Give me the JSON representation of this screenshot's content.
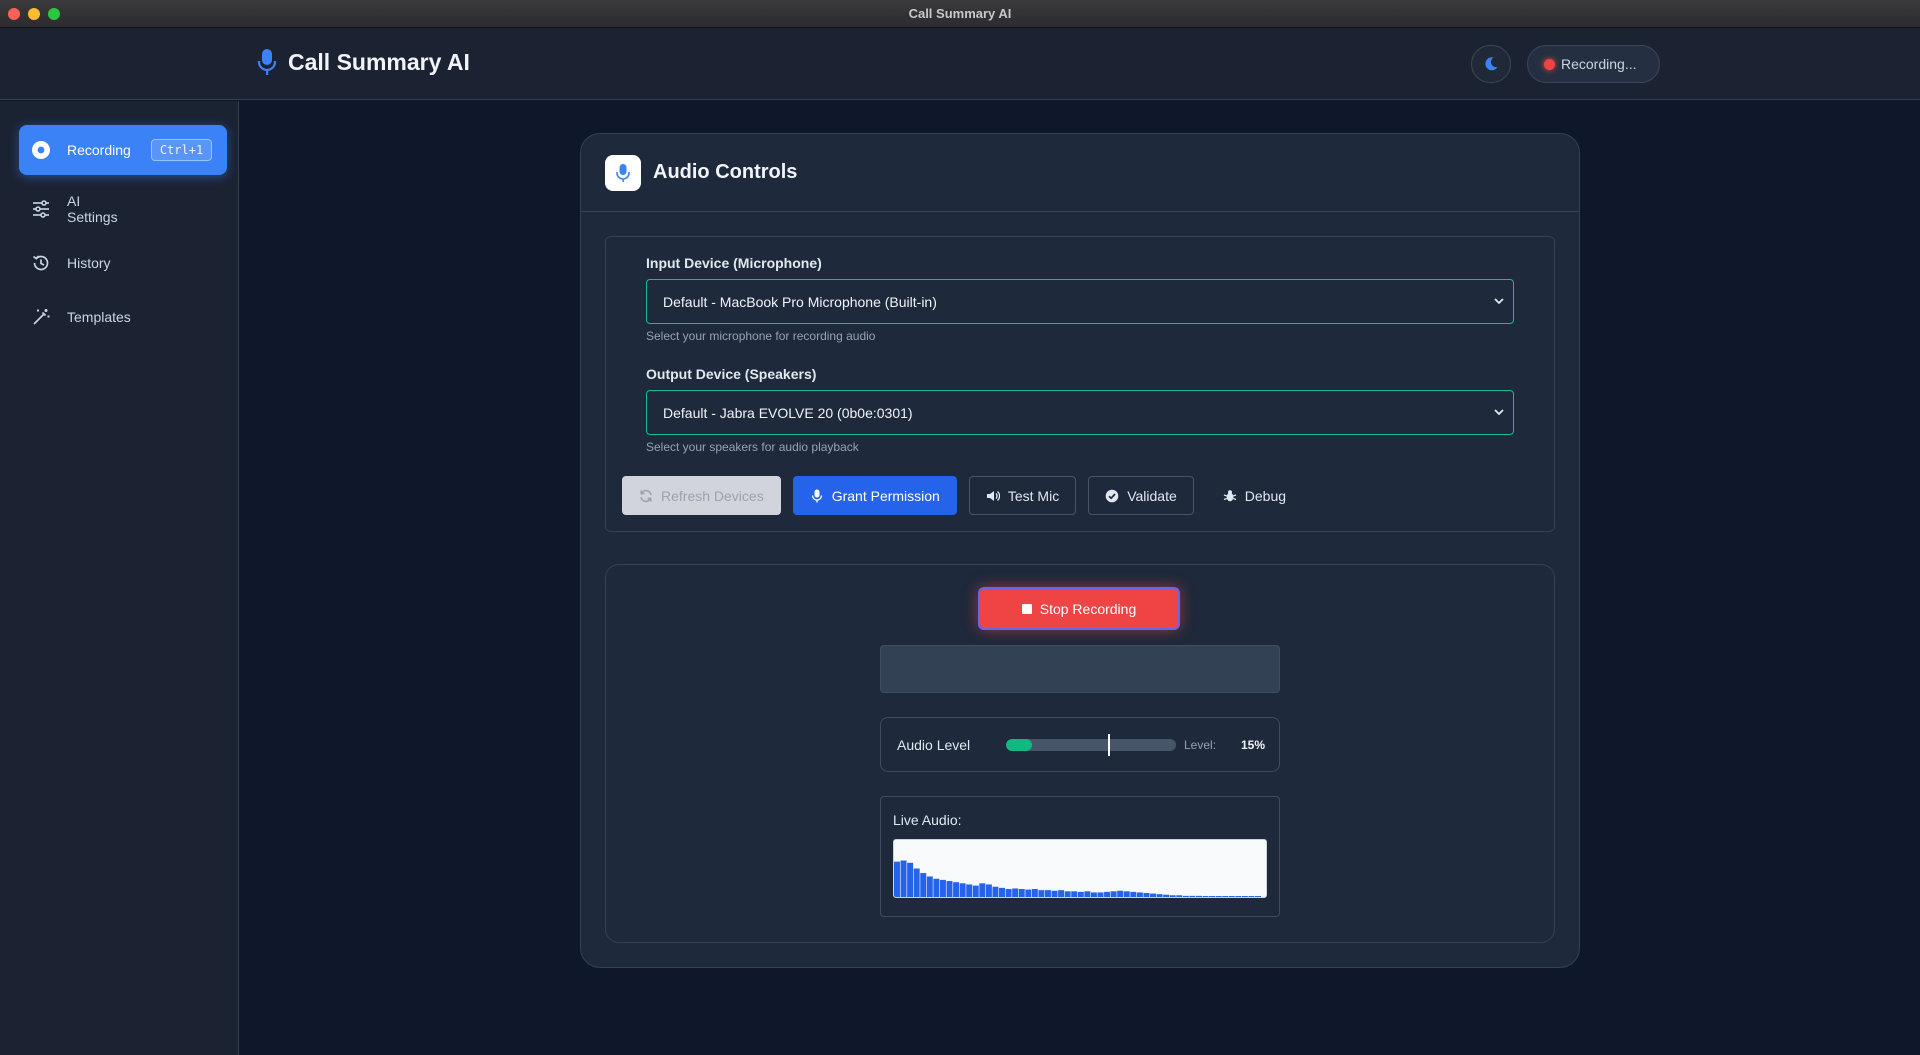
{
  "window": {
    "title": "Call Summary AI"
  },
  "header": {
    "app_title": "Call Summary AI",
    "recording_status": "Recording..."
  },
  "sidebar": {
    "items": [
      {
        "label": "Recording",
        "shortcut": "Ctrl+1",
        "icon": "record-icon",
        "active": true
      },
      {
        "label": "AI\nSettings",
        "icon": "sliders-icon",
        "active": false
      },
      {
        "label": "History",
        "icon": "history-icon",
        "active": false
      },
      {
        "label": "Templates",
        "icon": "magic-wand-icon",
        "active": false
      }
    ]
  },
  "card": {
    "title": "Audio Controls",
    "input_device": {
      "label": "Input Device (Microphone)",
      "value": "Default - MacBook Pro Microphone (Built-in)",
      "hint": "Select your microphone for recording audio"
    },
    "output_device": {
      "label": "Output Device (Speakers)",
      "value": "Default - Jabra EVOLVE 20 (0b0e:0301)",
      "hint": "Select your speakers for audio playback"
    },
    "buttons": {
      "refresh": "Refresh Devices",
      "grant": "Grant Permission",
      "test_mic": "Test Mic",
      "validate": "Validate",
      "debug": "Debug"
    }
  },
  "recording": {
    "stop_label": "Stop Recording",
    "audio_level_label": "Audio Level",
    "level_text": "Level:",
    "level_value": "15%",
    "level_fraction": 0.15,
    "live_audio_label": "Live Audio:",
    "waveform_levels": [
      0.62,
      0.64,
      0.6,
      0.5,
      0.42,
      0.36,
      0.32,
      0.3,
      0.28,
      0.26,
      0.24,
      0.22,
      0.2,
      0.24,
      0.22,
      0.18,
      0.16,
      0.14,
      0.15,
      0.14,
      0.13,
      0.14,
      0.12,
      0.12,
      0.11,
      0.12,
      0.1,
      0.1,
      0.09,
      0.1,
      0.08,
      0.08,
      0.09,
      0.1,
      0.11,
      0.1,
      0.09,
      0.08,
      0.07,
      0.06,
      0.05,
      0.04,
      0.03,
      0.03,
      0.02,
      0.02,
      0.02,
      0.01,
      0.01,
      0.01,
      0.01,
      0.01,
      0.01,
      0.01,
      0.01,
      0.01
    ]
  },
  "colors": {
    "accent": "#3b82f6",
    "record_red": "#ef4444",
    "level_green": "#10b981",
    "select_border": "#14b8a6"
  }
}
